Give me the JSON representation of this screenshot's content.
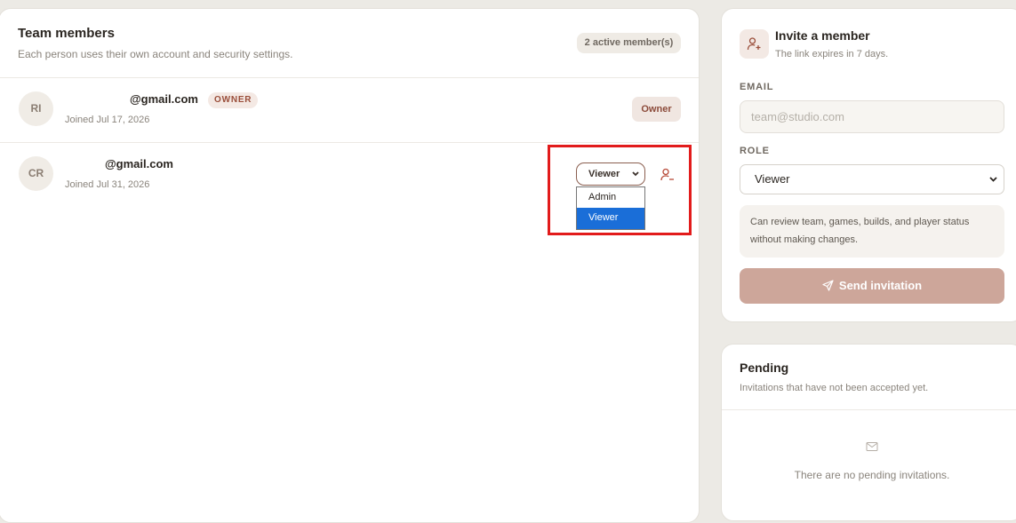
{
  "team": {
    "title": "Team members",
    "subtitle": "Each person uses their own account and security settings.",
    "active_count": "2 active member(s)",
    "members": [
      {
        "initials": "RI",
        "email": "@gmail.com",
        "badge": "OWNER",
        "joined": "Joined Jul 17, 2026",
        "role": "Owner"
      },
      {
        "initials": "CR",
        "email": "@gmail.com",
        "joined": "Joined Jul 31, 2026",
        "role": "Viewer",
        "role_options": [
          "Admin",
          "Viewer"
        ],
        "selected_option": "Viewer"
      }
    ]
  },
  "invite": {
    "title": "Invite a member",
    "subtitle": "The link expires in 7 days.",
    "email_label": "EMAIL",
    "email_placeholder": "team@studio.com",
    "role_label": "ROLE",
    "role_value": "Viewer",
    "role_description": "Can review team, games, builds, and player status without making changes.",
    "send_label": "Send invitation"
  },
  "pending": {
    "title": "Pending",
    "subtitle": "Invitations that have not been accepted yet.",
    "empty_text": "There are no pending invitations."
  },
  "icons": {
    "remove_member": "user-minus-icon",
    "invite": "user-plus-icon",
    "send": "paper-plane-icon",
    "empty": "mail-check-icon"
  },
  "colors": {
    "accent": "#9a4e3a",
    "send_button": "#cda69a",
    "selected_option": "#1a6ed8",
    "highlight": "#e21b1b"
  }
}
